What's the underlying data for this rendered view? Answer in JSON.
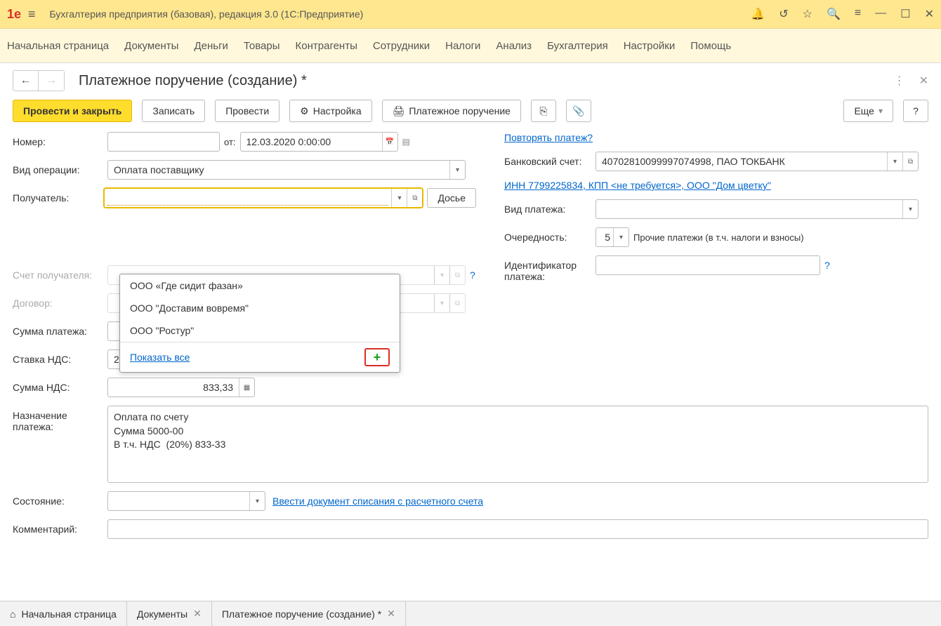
{
  "title": "Бухгалтерия предприятия (базовая), редакция 3.0  (1С:Предприятие)",
  "menu": [
    "Начальная страница",
    "Документы",
    "Деньги",
    "Товары",
    "Контрагенты",
    "Сотрудники",
    "Налоги",
    "Анализ",
    "Бухгалтерия",
    "Настройки",
    "Помощь"
  ],
  "doc_title": "Платежное поручение (создание) *",
  "toolbar": {
    "post_close": "Провести и закрыть",
    "save": "Записать",
    "post": "Провести",
    "settings": "Настройка",
    "print": "Платежное поручение",
    "more": "Еще",
    "help": "?"
  },
  "labels": {
    "number": "Номер:",
    "from": "от:",
    "operation": "Вид операции:",
    "recipient": "Получатель:",
    "recipient_account": "Счет получателя:",
    "contract": "Договор:",
    "dossier": "Досье",
    "sum": "Сумма платежа:",
    "vat_rate": "Ставка НДС:",
    "vat_sum": "Сумма НДС:",
    "purpose": "Назначение\nплатежа:",
    "status": "Состояние:",
    "comment": "Комментарий:",
    "repeat": "Повторять платеж?",
    "bank_account": "Банковский счет:",
    "inn_link": "ИНН 7799225834, КПП <не требуется>, ООО \"Дом цветку\"",
    "payment_type": "Вид платежа:",
    "priority": "Очередность:",
    "priority_desc": "Прочие платежи (в т.ч. налоги и взносы)",
    "identifier": "Идентификатор\nплатежа:",
    "writeoff_link": "Ввести документ списания с расчетного счета"
  },
  "values": {
    "date": "12.03.2020  0:00:00",
    "operation": "Оплата поставщику",
    "bank_account": "40702810099997074998, ПАО ТОКБАНК",
    "priority": "5",
    "vat_rate": "20%",
    "vat_sum": "833,33",
    "purpose": "Оплата по счету\nСумма 5000-00\nВ т.ч. НДС  (20%) 833-33"
  },
  "dropdown": {
    "items": [
      "ООО «Где сидит фазан»",
      "ООО \"Доставим вовремя\"",
      "ООО \"Ростур\""
    ],
    "show_all": "Показать все"
  },
  "tabs": [
    {
      "label": "Начальная страница",
      "close": false,
      "home": true
    },
    {
      "label": "Документы",
      "close": true
    },
    {
      "label": "Платежное поручение (создание) *",
      "close": true
    }
  ]
}
